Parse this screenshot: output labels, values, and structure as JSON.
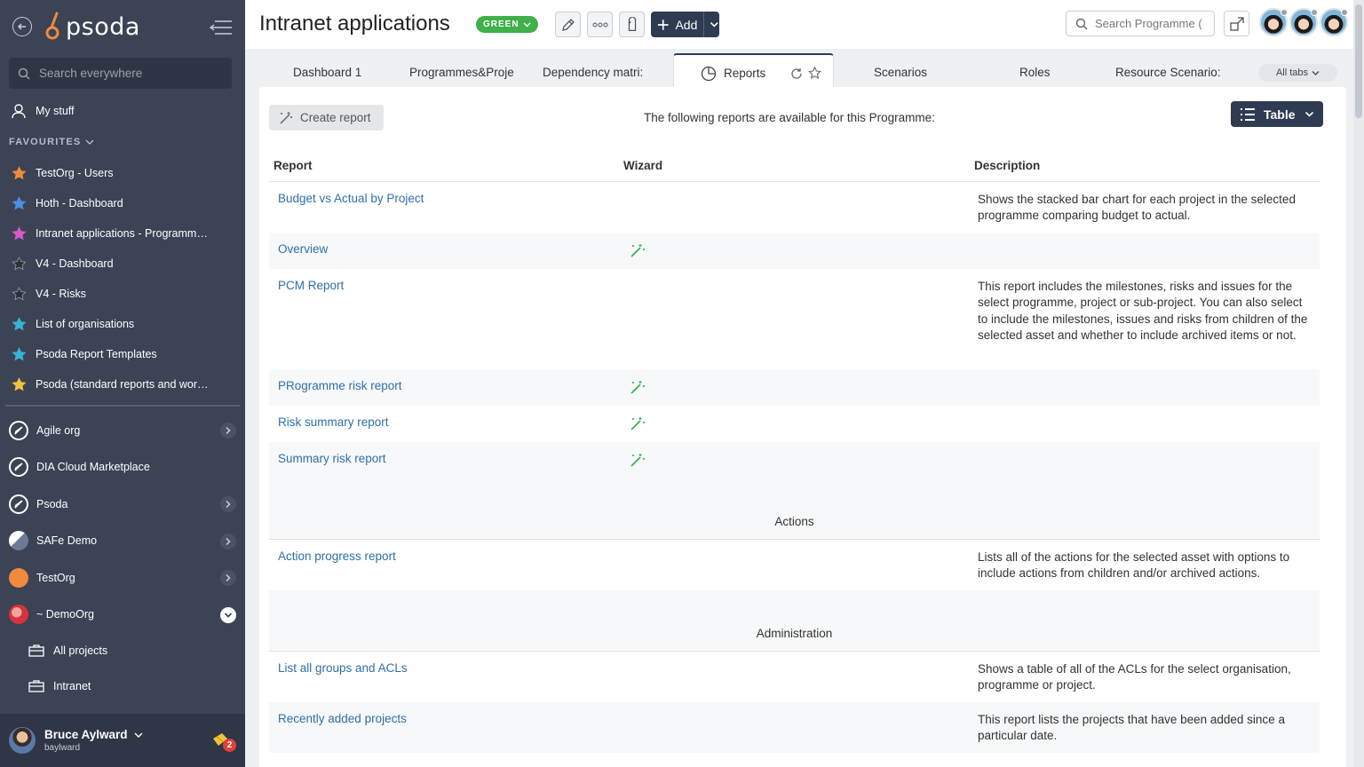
{
  "sidebar": {
    "logo_text": "psoda",
    "search_placeholder": "Search everywhere",
    "my_stuff": "My stuff",
    "favourites_label": "FAVOURITES",
    "favourites": [
      {
        "label": "TestOrg - Users",
        "color": "#f08a3c"
      },
      {
        "label": "Hoth - Dashboard",
        "color": "#4b8fe0"
      },
      {
        "label": "Intranet applications - Programme…",
        "color": "#d65ac9"
      },
      {
        "label": "V4 - Dashboard",
        "color": "#2b2f38"
      },
      {
        "label": "V4 - Risks",
        "color": "#2b2f38"
      },
      {
        "label": "List of organisations",
        "color": "#36b5d3"
      },
      {
        "label": "Psoda Report Templates",
        "color": "#36b5d3"
      },
      {
        "label": "Psoda (standard reports and work…",
        "color": "#f2c23c"
      }
    ],
    "orgs": [
      {
        "label": "Agile org",
        "expandable": true
      },
      {
        "label": "DIA Cloud Marketplace",
        "expandable": false
      },
      {
        "label": "Psoda",
        "expandable": true
      },
      {
        "label": "SAFe Demo",
        "expandable": true
      },
      {
        "label": "TestOrg",
        "expandable": true
      },
      {
        "label": "~ DemoOrg",
        "expandable": true
      }
    ],
    "sub_items": [
      "All projects",
      "Intranet"
    ],
    "user": {
      "name": "Bruce Aylward",
      "username": "baylward",
      "notifications": "2"
    }
  },
  "header": {
    "title": "Intranet applications",
    "status": "GREEN",
    "add_label": "Add",
    "search_placeholder": "Search Programme (",
    "colors": {
      "status": "#3fb04a",
      "primary": "#2f3b52"
    }
  },
  "tabs": [
    {
      "label": "Dashboard 1"
    },
    {
      "label": "Programmes&Projе"
    },
    {
      "label": "Dependency matri:"
    },
    {
      "label": "Reports",
      "active": true
    },
    {
      "label": "Scenarios"
    },
    {
      "label": "Roles"
    },
    {
      "label": "Resource Scenario:"
    }
  ],
  "all_tabs_label": "All tabs",
  "main": {
    "create_report": "Create report",
    "intro": "The following reports are available for this Programme:",
    "view_label": "Table",
    "columns": {
      "report": "Report",
      "wizard": "Wizard",
      "description": "Description"
    },
    "reports": [
      {
        "name": "Budget vs Actual by Project",
        "wizard": false,
        "description": "Shows the stacked bar chart for each project in the selected programme comparing budget to actual."
      },
      {
        "name": "Overview",
        "wizard": true,
        "description": ""
      },
      {
        "name": "PCM Report",
        "wizard": false,
        "description": "This report includes the milestones, risks and issues for the select programme, project or sub-project. You can also select to include the milestones, issues and risks from children of the selected asset and whether to include archived items or not."
      },
      {
        "name": "PRogramme risk report",
        "wizard": true,
        "description": ""
      },
      {
        "name": "Risk summary report",
        "wizard": true,
        "description": ""
      },
      {
        "name": "Summary risk report",
        "wizard": true,
        "description": ""
      }
    ],
    "sections": [
      {
        "title": "Actions",
        "reports": [
          {
            "name": "Action progress report",
            "description": "Lists all of the actions for the selected asset with options to include actions from children and/or archived actions."
          }
        ]
      },
      {
        "title": "Administration",
        "reports": [
          {
            "name": "List all groups and ACLs",
            "description": "Shows a table of all of the ACLs for the select organisation, programme or project."
          },
          {
            "name": "Recently added projects",
            "description": "This report lists the projects that have been added since a particular date."
          }
        ]
      }
    ]
  }
}
